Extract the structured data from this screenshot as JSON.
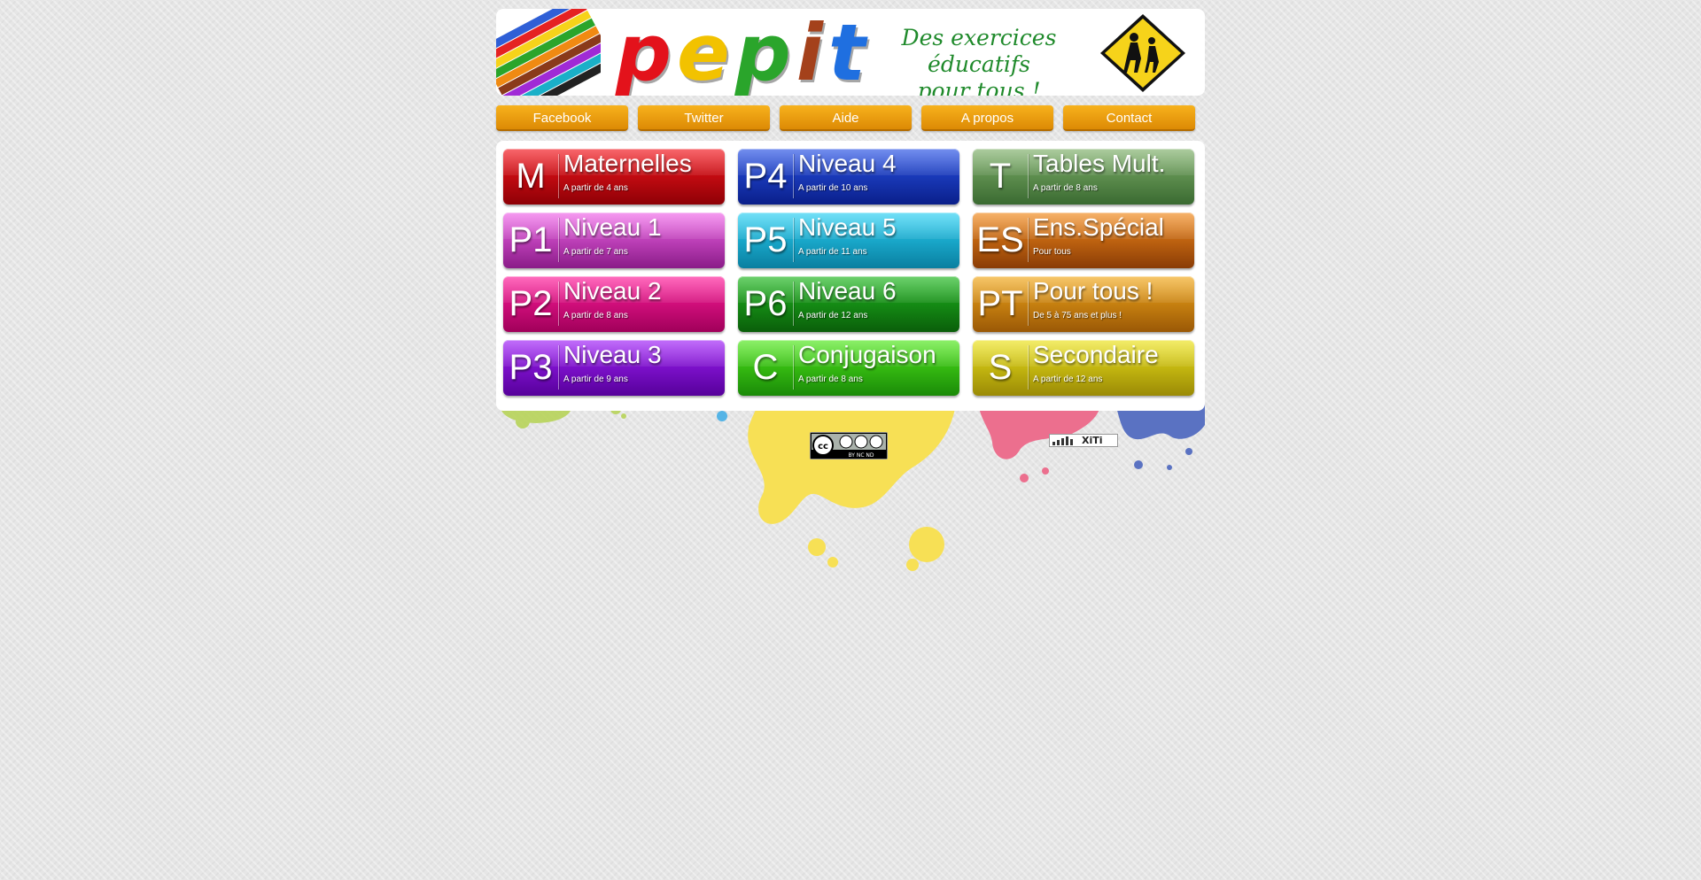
{
  "header": {
    "logo_letters": [
      {
        "char": "p",
        "color": "#e3121b"
      },
      {
        "char": "e",
        "color": "#f2c200"
      },
      {
        "char": "p",
        "color": "#2aa52b"
      },
      {
        "char": "i",
        "color": "#a4411b"
      },
      {
        "char": "t",
        "color": "#1f6fe0"
      }
    ],
    "tagline_line1": "Des exercices éducatifs",
    "tagline_line2": "pour tous !"
  },
  "nav": {
    "items": [
      {
        "label": "Facebook"
      },
      {
        "label": "Twitter"
      },
      {
        "label": "Aide"
      },
      {
        "label": "A propos"
      },
      {
        "label": "Contact"
      }
    ],
    "color": "#f0a412"
  },
  "levels": [
    {
      "code": "M",
      "name": "Maternelles",
      "age": "A partir de 4 ans",
      "color_top": "#f4151c",
      "color_bottom": "#8e0006"
    },
    {
      "code": "P4",
      "name": "Niveau 4",
      "age": "A partir de 10 ans",
      "color_top": "#2852e6",
      "color_bottom": "#0a1f8a"
    },
    {
      "code": "T",
      "name": "Tables Mult.",
      "age": "A partir de 8 ans",
      "color_top": "#7fb06a",
      "color_bottom": "#3a6a31"
    },
    {
      "code": "P1",
      "name": "Niveau 1",
      "age": "A partir de 7 ans",
      "color_top": "#f064e8",
      "color_bottom": "#8a1c88"
    },
    {
      "code": "P5",
      "name": "Niveau 5",
      "age": "A partir de 11 ans",
      "color_top": "#28d0f4",
      "color_bottom": "#0a7fa0"
    },
    {
      "code": "ES",
      "name": "Ens.Spécial",
      "age": "Pour tous",
      "color_top": "#f2891a",
      "color_bottom": "#8a3c06"
    },
    {
      "code": "P2",
      "name": "Niveau 2",
      "age": "A partir de 8 ans",
      "color_top": "#ff1c9a",
      "color_bottom": "#a0005a"
    },
    {
      "code": "P6",
      "name": "Niveau 6",
      "age": "A partir de 12 ans",
      "color_top": "#1fb81f",
      "color_bottom": "#0a5e0a"
    },
    {
      "code": "PT",
      "name": "Pour tous !",
      "age": "De 5 à 75 ans et plus !",
      "color_top": "#f2a81a",
      "color_bottom": "#9a5806"
    },
    {
      "code": "P3",
      "name": "Niveau 3",
      "age": "A partir de 9 ans",
      "color_top": "#a020f8",
      "color_bottom": "#56009a"
    },
    {
      "code": "C",
      "name": "Conjugaison",
      "age": "A partir de 8 ans",
      "color_top": "#4fe81a",
      "color_bottom": "#1a8a08"
    },
    {
      "code": "S",
      "name": "Secondaire",
      "age": "A partir de 12 ans",
      "color_top": "#ece21a",
      "color_bottom": "#9a8a06"
    }
  ],
  "footer": {
    "cc_badge_text": "BY NC ND",
    "xiti_label": "XiTi"
  }
}
